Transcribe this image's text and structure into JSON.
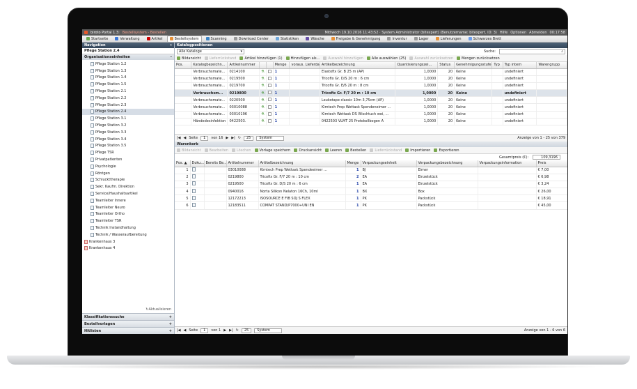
{
  "window": {
    "title_app": "biroto Portal 1.3:",
    "title_module": "Bestellsystem - Bestellen",
    "status_text": "Mittwoch 19.10.2016 11:43:52 · System Administrator (bitexpert) (Benutzername: bitexpert, ID: 3)",
    "help": "Hilfe",
    "options": "Optionen",
    "logout": "Abmelden",
    "time": "00:17:58"
  },
  "menu": [
    {
      "label": "Startseite",
      "icon": "home-icon",
      "color": "#6aa84f"
    },
    {
      "label": "Verwaltung",
      "icon": "folder-icon",
      "color": "#3c78d8"
    },
    {
      "label": "Artikel",
      "icon": "article-icon",
      "color": "#cc0000"
    },
    {
      "label": "Bestellsystem",
      "icon": "cart-icon",
      "color": "#e69138",
      "active": true
    },
    {
      "label": "Scanning",
      "icon": "scanner-icon",
      "color": "#3d85c6"
    },
    {
      "label": "Download Center",
      "icon": "download-icon",
      "color": "#999999"
    },
    {
      "label": "Statistiken",
      "icon": "chart-icon",
      "color": "#6fa8dc"
    },
    {
      "label": "Wäsche",
      "icon": "laundry-icon",
      "color": "#674ea7"
    },
    {
      "label": "Freigabe & Genehmigung",
      "icon": "approval-icon",
      "color": "#e69138"
    },
    {
      "label": "Inventur",
      "icon": "inventory-icon",
      "color": "#999999"
    },
    {
      "label": "Lager",
      "icon": "warehouse-icon",
      "color": "#999999"
    },
    {
      "label": "Lieferungen",
      "icon": "truck-icon",
      "color": "#e69138"
    },
    {
      "label": "Schwarzes Brett",
      "icon": "board-icon",
      "color": "#6d9eeb"
    }
  ],
  "sidebar": {
    "navigation_title": "Navigation",
    "collapse_symbol": "«",
    "current_station": "Pflege Station 2.4",
    "org_title": "Organisationseinheiten",
    "org_collapse": "–",
    "tree": [
      "Pflege Station 1.2",
      "Pflege Station 1.3",
      "Pflege Station 1.4",
      "Pflege Station 1.5",
      "Pflege Station 2.1",
      "Pflege Station 2.2",
      "Pflege Station 2.3",
      "Pflege Station 2.4",
      "Pflege Station 3.1",
      "Pflege Station 3.2",
      "Pflege Station 3.3",
      "Pflege Station 3.4",
      "Pflege Station 3.5",
      "Pflege TSR",
      "Privatpatienten",
      "Psychologie",
      "Röntgen",
      "Schluckttherapie",
      "Sekr. Kaufm. Direktion",
      "Service/Haushaltsartikel",
      "Teamleiter Innere",
      "Teamleiter Neuro",
      "Teamleiter Ortho",
      "Teamleiter TSR",
      "Technik Instandhaltung",
      "Technik / Wasseraufbereitung"
    ],
    "hospitals": [
      "Krankenhaus 3",
      "Krankenhaus 4"
    ],
    "refresh": "Aktualisieren",
    "sections": [
      "Klassifikationssuche",
      "Bestellvorlagen",
      "Hitlisten"
    ],
    "plus": "+"
  },
  "catalog": {
    "title": "Katalogpositionen",
    "catalog_select": "Alle Kataloge",
    "search_label": "Suche:",
    "toolbar": [
      "Bildansicht",
      "Lieferrückstand",
      "Artikel hinzufügen (1)",
      "Hinzufügen als...",
      "Auswahl hinzufügen",
      "Alle auswählen (25)",
      "Auswahl zurücksetzen",
      "Mengen zurücksetzen"
    ],
    "columns": [
      "Pos.",
      "Katalogbezeichn...",
      "Artikelnummer",
      "",
      "",
      "Menge",
      "voraus. Lieferda...",
      "Artikelbezeichnung",
      "Quantisierungszei...",
      "Status",
      "Genehmigungsstufe",
      "Typ",
      "Typ intern",
      "Warengrupp"
    ],
    "rows": [
      {
        "kat": "Verbrauchsmate...",
        "nr": "0214100",
        "menge": "1",
        "bez": "Elastofix Gr. B 25 m (AP)",
        "q": "1,0000",
        "st": "20",
        "gen": "Keine",
        "ti": "undefiniert"
      },
      {
        "kat": "Verbrauchsmate...",
        "nr": "0219500",
        "menge": "1",
        "bez": "Tricofix Gr. D/S 20 m : 6 cm",
        "q": "1,0000",
        "st": "20",
        "gen": "Keine",
        "ti": "undefiniert"
      },
      {
        "kat": "Verbrauchsmate...",
        "nr": "0219700",
        "menge": "1",
        "bez": "Tricofix Gr. E/6 20 m : 8 cm",
        "q": "1,0000",
        "st": "20",
        "gen": "Keine",
        "ti": "undefiniert"
      },
      {
        "kat": "Verbrauchsm...",
        "nr": "0219800",
        "menge": "1",
        "bez": "Tricofix Gr. F/7 20 m : 10 cm",
        "q": "1,0000",
        "st": "20",
        "gen": "Keine",
        "ti": "undefiniert",
        "bold": true
      },
      {
        "kat": "Verbrauchsmate...",
        "nr": "0220500",
        "menge": "1",
        "bez": "Leukotape classic 10m 3,75cm (AP)",
        "q": "1,0000",
        "st": "20",
        "gen": "Keine",
        "ti": "undefiniert"
      },
      {
        "kat": "Verbrauchsmate...",
        "nr": "03010088",
        "menge": "1",
        "bez": "Kimtech Prep Wettask Spendeneimer ...",
        "q": "1,0000",
        "st": "20",
        "gen": "Keine",
        "ti": "undefiniert"
      },
      {
        "kat": "Verbrauchsmate...",
        "nr": "03010196",
        "menge": "1",
        "bez": "Kimtech Wettask DS Wischtuch wei, ...",
        "q": "1,0000",
        "st": "20",
        "gen": "Keine",
        "ti": "undefiniert"
      },
      {
        "kat": "Händedesinfektion",
        "nr": "0422503.",
        "menge": "1",
        "bez": "0422503 VLMT 25 Protokollbogen A",
        "q": "1,0000",
        "st": "20",
        "gen": "Keine",
        "ti": "undefiniert"
      }
    ],
    "pager": {
      "page_label": "Seite",
      "page": "1",
      "of": "von 16",
      "per_page": "25",
      "view": "System",
      "info": "Anzeige von 1 - 25 von 379"
    }
  },
  "basket": {
    "title": "Warenkorb",
    "toolbar": [
      "Bildansicht",
      "Bearbeiten",
      "Löschen",
      "Vorlage speichern",
      "Druckansicht",
      "Leeren",
      "Bestellen",
      "Lieferrückstand",
      "Importieren",
      "Exportieren"
    ],
    "total_label": "Gesamtpreis (€):",
    "total_value": "109,3196",
    "columns": [
      "Pos. ▲",
      "Doku...",
      "Bereits Be...",
      "Artikelnummer",
      "Artikelbezeichnung",
      "Menge",
      "Verpackungseinheit",
      "Verpackungsbezeichnung",
      "Verpackungsinformation",
      "Preis"
    ],
    "rows": [
      {
        "pos": "1",
        "nr": "03010088",
        "bez": "Kimtech Prep Wettask Spendeeimer ...",
        "menge": "1",
        "ve": "BJ",
        "vb": "Eimer",
        "preis": "€ 7,00"
      },
      {
        "pos": "2",
        "nr": "0219800",
        "bez": "Tricofix Gr. F/7 20 m : 10 cm",
        "menge": "2",
        "ve": "EA",
        "vb": "Einzelstück",
        "preis": "€ 6,98"
      },
      {
        "pos": "3",
        "nr": "0219500",
        "bez": "Tricofix Gr. D/S 20 m : 6 cm",
        "menge": "1",
        "ve": "EA",
        "vb": "Einzelstück",
        "preis": "€ 3,24"
      },
      {
        "pos": "4",
        "nr": "0940016",
        "bez": "Norta Silikon Nelaton 16Ch, 10ml",
        "menge": "1",
        "ve": "BX",
        "vb": "Box",
        "preis": "€ 26,00"
      },
      {
        "pos": "5",
        "nr": "12172213",
        "bez": "ISOSOURCE E FIB SOJ S FLEX",
        "menge": "1",
        "ve": "PK",
        "vb": "Packstück",
        "preis": "€ 18,91"
      },
      {
        "pos": "6",
        "nr": "12183511",
        "bez": "COMPAT STAND/P7000+UNI EN",
        "menge": "1",
        "ve": "PK",
        "vb": "Packstück",
        "preis": "€ 45,00"
      }
    ],
    "pager": {
      "page_label": "Seite",
      "page": "1",
      "of": "von 1",
      "per_page": "25",
      "view": "System",
      "info": "Anzeige von 1 - 6 von 6"
    }
  }
}
